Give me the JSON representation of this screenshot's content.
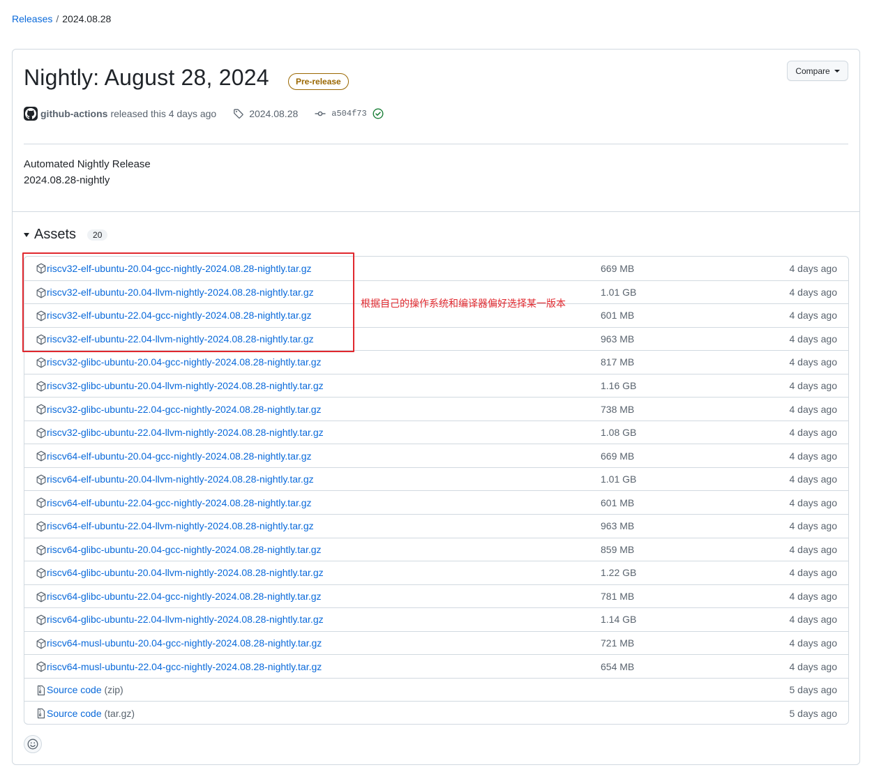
{
  "breadcrumb": {
    "parent": "Releases",
    "separator": "/",
    "current": "2024.08.28"
  },
  "release": {
    "title": "Nightly: August 28, 2024",
    "badge": "Pre-release",
    "compare_label": "Compare",
    "author": "github-actions",
    "released_text": "released this 4 days ago",
    "tag": "2024.08.28",
    "commit": "a504f73",
    "notes_heading": "Automated Nightly Release",
    "notes_body": "2024.08.28-nightly"
  },
  "assets": {
    "title": "Assets",
    "count": "20",
    "items": [
      {
        "name": "riscv32-elf-ubuntu-20.04-gcc-nightly-2024.08.28-nightly.tar.gz",
        "size": "669 MB",
        "date": "4 days ago"
      },
      {
        "name": "riscv32-elf-ubuntu-20.04-llvm-nightly-2024.08.28-nightly.tar.gz",
        "size": "1.01 GB",
        "date": "4 days ago"
      },
      {
        "name": "riscv32-elf-ubuntu-22.04-gcc-nightly-2024.08.28-nightly.tar.gz",
        "size": "601 MB",
        "date": "4 days ago"
      },
      {
        "name": "riscv32-elf-ubuntu-22.04-llvm-nightly-2024.08.28-nightly.tar.gz",
        "size": "963 MB",
        "date": "4 days ago"
      },
      {
        "name": "riscv32-glibc-ubuntu-20.04-gcc-nightly-2024.08.28-nightly.tar.gz",
        "size": "817 MB",
        "date": "4 days ago"
      },
      {
        "name": "riscv32-glibc-ubuntu-20.04-llvm-nightly-2024.08.28-nightly.tar.gz",
        "size": "1.16 GB",
        "date": "4 days ago"
      },
      {
        "name": "riscv32-glibc-ubuntu-22.04-gcc-nightly-2024.08.28-nightly.tar.gz",
        "size": "738 MB",
        "date": "4 days ago"
      },
      {
        "name": "riscv32-glibc-ubuntu-22.04-llvm-nightly-2024.08.28-nightly.tar.gz",
        "size": "1.08 GB",
        "date": "4 days ago"
      },
      {
        "name": "riscv64-elf-ubuntu-20.04-gcc-nightly-2024.08.28-nightly.tar.gz",
        "size": "669 MB",
        "date": "4 days ago"
      },
      {
        "name": "riscv64-elf-ubuntu-20.04-llvm-nightly-2024.08.28-nightly.tar.gz",
        "size": "1.01 GB",
        "date": "4 days ago"
      },
      {
        "name": "riscv64-elf-ubuntu-22.04-gcc-nightly-2024.08.28-nightly.tar.gz",
        "size": "601 MB",
        "date": "4 days ago"
      },
      {
        "name": "riscv64-elf-ubuntu-22.04-llvm-nightly-2024.08.28-nightly.tar.gz",
        "size": "963 MB",
        "date": "4 days ago"
      },
      {
        "name": "riscv64-glibc-ubuntu-20.04-gcc-nightly-2024.08.28-nightly.tar.gz",
        "size": "859 MB",
        "date": "4 days ago"
      },
      {
        "name": "riscv64-glibc-ubuntu-20.04-llvm-nightly-2024.08.28-nightly.tar.gz",
        "size": "1.22 GB",
        "date": "4 days ago"
      },
      {
        "name": "riscv64-glibc-ubuntu-22.04-gcc-nightly-2024.08.28-nightly.tar.gz",
        "size": "781 MB",
        "date": "4 days ago"
      },
      {
        "name": "riscv64-glibc-ubuntu-22.04-llvm-nightly-2024.08.28-nightly.tar.gz",
        "size": "1.14 GB",
        "date": "4 days ago"
      },
      {
        "name": "riscv64-musl-ubuntu-20.04-gcc-nightly-2024.08.28-nightly.tar.gz",
        "size": "721 MB",
        "date": "4 days ago"
      },
      {
        "name": "riscv64-musl-ubuntu-22.04-gcc-nightly-2024.08.28-nightly.tar.gz",
        "size": "654 MB",
        "date": "4 days ago"
      }
    ],
    "source": [
      {
        "label": "Source code",
        "format": "(zip)",
        "date": "5 days ago"
      },
      {
        "label": "Source code",
        "format": "(tar.gz)",
        "date": "5 days ago"
      }
    ]
  },
  "annotation": {
    "text": "根据自己的操作系统和编译器偏好选择某一版本",
    "color": "#e0282e"
  },
  "colors": {
    "link": "#0969da",
    "muted": "#59636e",
    "border": "#d1d9e0",
    "badge": "#9a6700",
    "success": "#1a7f37"
  },
  "icons": [
    "package-icon",
    "file-zip-icon",
    "tag-icon",
    "commit-icon",
    "check-circle-icon",
    "smiley-icon",
    "github-avatar-icon"
  ]
}
